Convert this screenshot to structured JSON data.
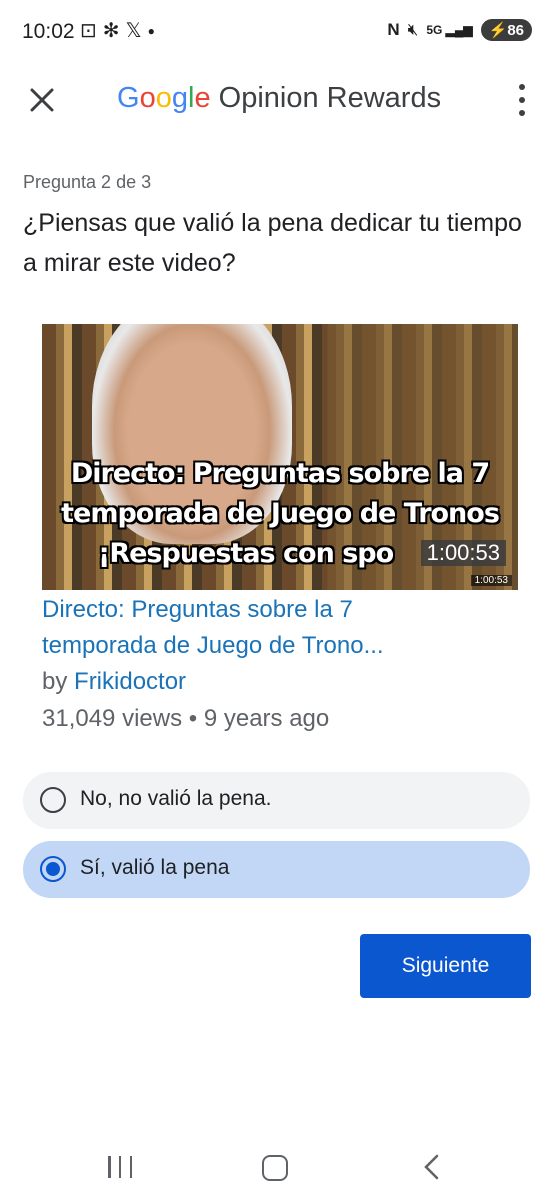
{
  "status_bar": {
    "time": "10:02",
    "left_icons": [
      "screenshot-icon",
      "fan-icon",
      "x-logo-icon",
      "dot-icon"
    ],
    "right_icons": [
      "nfc-icon",
      "mute-icon",
      "5g-signal-icon"
    ],
    "battery": "86"
  },
  "app_bar": {
    "brand": [
      "G",
      "o",
      "o",
      "g",
      "l",
      "e"
    ],
    "brand_colors": [
      "#4285F4",
      "#EA4335",
      "#FBBC05",
      "#4285F4",
      "#34A853",
      "#EA4335"
    ],
    "title": "Opinion Rewards"
  },
  "survey": {
    "progress": "Pregunta 2 de 3",
    "question": "¿Piensas que valió la pena dedicar tu tiempo a mirar este video?"
  },
  "video": {
    "overlay_lines": [
      "Directo: Preguntas sobre la 7",
      "temporada de Juego de Tronos",
      "¡Respuestas con spo"
    ],
    "duration": "1:00:53",
    "duration_small": "1:00:53",
    "title_line1": "Directo: Preguntas sobre la 7",
    "title_line2": "temporada de Juego de Trono...",
    "by": "by",
    "channel": "Frikidoctor",
    "stats": "31,049 views • 9 years ago"
  },
  "options": [
    {
      "label": "No, no valió la pena.",
      "selected": false
    },
    {
      "label": "Sí, valió la pena",
      "selected": true
    }
  ],
  "next_button": "Siguiente",
  "colors": {
    "accent": "#0b57d0",
    "selected_bg": "#c2d7f6",
    "link": "#1a73b8"
  }
}
